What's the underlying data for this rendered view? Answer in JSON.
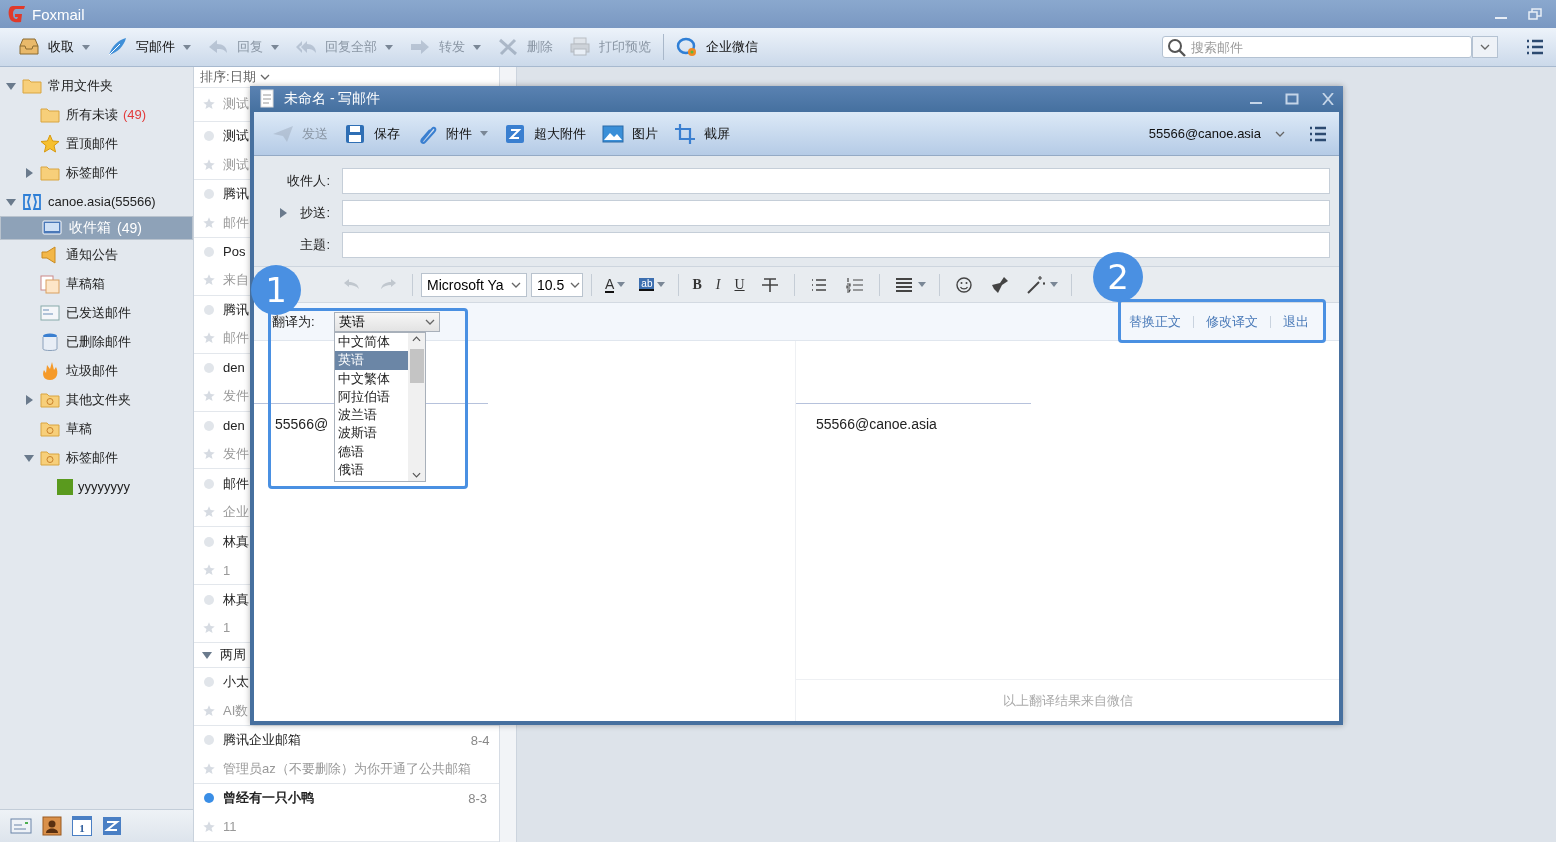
{
  "app": {
    "title": "Foxmail"
  },
  "toolbar": {
    "buttons": [
      {
        "kind": "receive",
        "label": "收取",
        "menu": true,
        "disabled": false
      },
      {
        "kind": "compose",
        "label": "写邮件",
        "menu": true,
        "disabled": false
      },
      {
        "kind": "reply",
        "label": "回复",
        "menu": true,
        "disabled": true
      },
      {
        "kind": "reply-all",
        "label": "回复全部",
        "menu": true,
        "disabled": true
      },
      {
        "kind": "forward",
        "label": "转发",
        "menu": true,
        "disabled": true
      },
      {
        "kind": "delete",
        "label": "删除",
        "menu": false,
        "disabled": true
      },
      {
        "kind": "print",
        "label": "打印预览",
        "menu": false,
        "disabled": true
      },
      {
        "kind": "wework",
        "label": "企业微信",
        "menu": false,
        "disabled": false
      }
    ],
    "search": {
      "placeholder": "搜索邮件"
    }
  },
  "sidebar": {
    "tree": [
      {
        "kind": "folder",
        "label": "常用文件夹",
        "expanded": true,
        "selected": false,
        "children": [
          {
            "kind": "folder",
            "label": "所有未读",
            "count": "(49)",
            "selected": false
          },
          {
            "kind": "star",
            "label": "置顶邮件",
            "selected": false
          },
          {
            "kind": "tag",
            "label": "标签邮件",
            "expanded": false,
            "selected": false
          }
        ]
      },
      {
        "kind": "account",
        "label": "canoe.asia(55566)",
        "expanded": true,
        "selected": false,
        "children": [
          {
            "kind": "inbox",
            "label": "收件箱",
            "count": "(49)",
            "selected": true
          },
          {
            "kind": "notice",
            "label": "通知公告",
            "selected": false
          },
          {
            "kind": "drafts",
            "label": "草稿箱",
            "selected": false
          },
          {
            "kind": "sent",
            "label": "已发送邮件",
            "selected": false
          },
          {
            "kind": "trash",
            "label": "已删除邮件",
            "selected": false
          },
          {
            "kind": "spam",
            "label": "垃圾邮件",
            "selected": false
          },
          {
            "kind": "sync-folder",
            "label": "其他文件夹",
            "expanded": false,
            "selected": false
          },
          {
            "kind": "sync-folder",
            "label": "草稿",
            "selected": false
          },
          {
            "kind": "sync-folder",
            "label": "标签邮件",
            "expanded": true,
            "selected": false,
            "children": [
              {
                "kind": "label",
                "label": "yyyyyyyy",
                "color": "#5a9a1e",
                "selected": false
              }
            ]
          }
        ]
      }
    ],
    "nav": [
      {
        "kind": "mail"
      },
      {
        "kind": "contacts"
      },
      {
        "kind": "calendar",
        "label": "1"
      },
      {
        "kind": "netdisk"
      }
    ]
  },
  "mail_list": {
    "sort": "排序:日期",
    "rows": [
      {
        "kind": "mail",
        "preview": "测试"
      },
      {
        "kind": "mail",
        "title": "测试",
        "preview": "测试",
        "unread": false
      },
      {
        "kind": "mail",
        "title": "腾讯",
        "preview": "邮件",
        "unread": false
      },
      {
        "kind": "mail",
        "title": "Pos",
        "preview": "来自",
        "unread": false
      },
      {
        "kind": "mail",
        "title": "腾讯",
        "preview": "邮件",
        "unread": false
      },
      {
        "kind": "mail",
        "title": "den",
        "preview": "发件",
        "unread": false
      },
      {
        "kind": "mail",
        "title": "den",
        "preview": "发件",
        "unread": false
      },
      {
        "kind": "mail",
        "title": "邮件",
        "preview": "企业",
        "unread": false
      },
      {
        "kind": "mail",
        "title": "林真",
        "preview": "1",
        "unread": false
      },
      {
        "kind": "mail",
        "title": "林真",
        "preview": "1",
        "unread": false
      },
      {
        "kind": "group",
        "title": "两周",
        "expanded": true
      },
      {
        "kind": "mail",
        "title": "小太",
        "preview": "AI数",
        "unread": false
      },
      {
        "kind": "mail",
        "title": "腾讯企业邮箱",
        "date": "8-4",
        "preview": "管理员az（不要删除）为你开通了公共邮箱",
        "unread": false
      },
      {
        "kind": "mail",
        "title": "曾经有一只小鸭",
        "date": "8-3",
        "preview": "11",
        "unread": true
      }
    ]
  },
  "compose": {
    "title": "未命名 - 写邮件",
    "toolbar": {
      "buttons": [
        {
          "kind": "send",
          "label": "发送",
          "menu": false,
          "disabled": true
        },
        {
          "kind": "save",
          "label": "保存",
          "menu": false,
          "disabled": false
        },
        {
          "kind": "attach",
          "label": "附件",
          "menu": true,
          "disabled": false
        },
        {
          "kind": "big-attach",
          "label": "超大附件",
          "menu": false,
          "disabled": false
        },
        {
          "kind": "image",
          "label": "图片",
          "menu": false,
          "disabled": false
        },
        {
          "kind": "screenshot",
          "label": "截屏",
          "menu": false,
          "disabled": false
        }
      ],
      "account": "55566@canoe.asia"
    },
    "fields": [
      {
        "label": "收件人:"
      },
      {
        "label": "抄送:",
        "expanded": false
      },
      {
        "label": "主题:"
      }
    ],
    "format_bar": {
      "font": "Microsoft Ya",
      "size": "10.5",
      "groups": [
        [
          {
            "kind": "undo",
            "disabled": true,
            "menu": false
          },
          {
            "kind": "redo",
            "disabled": true,
            "menu": false
          }
        ],
        [
          {
            "kind": "font-color",
            "label": "A",
            "disabled": false,
            "menu": true
          },
          {
            "kind": "highlight",
            "label": "ab",
            "disabled": false,
            "menu": true
          }
        ],
        [
          {
            "kind": "bold",
            "label": "B",
            "disabled": false,
            "menu": false
          },
          {
            "kind": "italic",
            "label": "I",
            "disabled": false,
            "menu": false
          },
          {
            "kind": "underline",
            "label": "U",
            "disabled": false,
            "menu": false
          },
          {
            "kind": "strike",
            "disabled": false,
            "menu": false
          }
        ],
        [
          {
            "kind": "bullets",
            "disabled": false,
            "menu": false
          },
          {
            "kind": "numbered",
            "disabled": false,
            "menu": false
          }
        ],
        [
          {
            "kind": "align",
            "disabled": false,
            "menu": true
          }
        ],
        [
          {
            "kind": "emoji",
            "disabled": false,
            "menu": false
          },
          {
            "kind": "brush",
            "disabled": false,
            "menu": false
          },
          {
            "kind": "magic",
            "disabled": false,
            "menu": true
          }
        ]
      ]
    },
    "translate": {
      "label": "翻译为:",
      "value": "英语",
      "options": [
        {
          "label": "中文简体",
          "selected": false
        },
        {
          "label": "英语",
          "selected": true
        },
        {
          "label": "中文繁体",
          "selected": false
        },
        {
          "label": "阿拉伯语",
          "selected": false
        },
        {
          "label": "波兰语",
          "selected": false
        },
        {
          "label": "波斯语",
          "selected": false
        },
        {
          "label": "德语",
          "selected": false
        },
        {
          "label": "俄语",
          "selected": false
        }
      ],
      "actions": [
        "替换正文",
        "修改译文",
        "退出"
      ]
    },
    "original": {
      "text": "55566@"
    },
    "translation": {
      "text": "55566@canoe.asia",
      "footer": "以上翻译结果来自微信"
    }
  },
  "callouts": [
    {
      "number": "1"
    },
    {
      "number": "2"
    }
  ]
}
